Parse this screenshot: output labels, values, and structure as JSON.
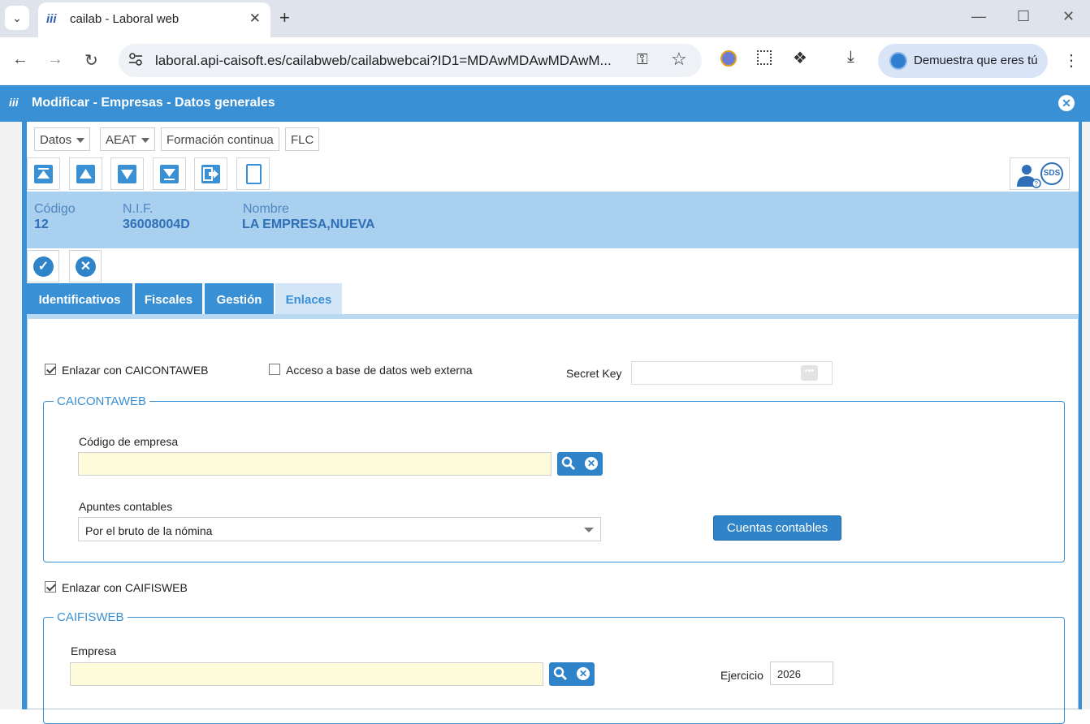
{
  "browser": {
    "tab_title": "cailab - Laboral web",
    "favicon_text": "iii",
    "url": "laboral.api-caisoft.es/cailabweb/cailabwebcai?ID1=MDAwMDAwMDAwM...",
    "profile_label": "Demuestra que eres tú"
  },
  "dialog": {
    "logo_text": "iii",
    "title": "Modificar - Empresas - Datos generales",
    "menus": [
      "Datos",
      "AEAT",
      "Formación continua",
      "FLC"
    ],
    "help_text": "SDS"
  },
  "record": {
    "codigo_label": "Código",
    "codigo_value": "12",
    "nif_label": "N.I.F.",
    "nif_value": "36008004D",
    "nombre_label": "Nombre",
    "nombre_value": "LA EMPRESA,NUEVA"
  },
  "tabs": [
    {
      "label": "Identificativos",
      "active": false
    },
    {
      "label": "Fiscales",
      "active": false
    },
    {
      "label": "Gestión",
      "active": false
    },
    {
      "label": "Enlaces",
      "active": true
    }
  ],
  "enlaces": {
    "enlazar_caicontaweb_label": "Enlazar con CAICONTAWEB",
    "enlazar_caicontaweb_checked": true,
    "acceso_externa_label": "Acceso a base de datos web externa",
    "acceso_externa_checked": false,
    "secret_key_label": "Secret Key",
    "secret_key_value": "",
    "caicontaweb_legend": "CAICONTAWEB",
    "codigo_empresa_label": "Código de empresa",
    "codigo_empresa_value": "",
    "apuntes_label": "Apuntes contables",
    "apuntes_value": "Por el bruto de la nómina",
    "cuentas_button": "Cuentas contables",
    "enlazar_caifisweb_label": "Enlazar con CAIFISWEB",
    "enlazar_caifisweb_checked": true,
    "caifisweb_legend": "CAIFISWEB",
    "empresa_label": "Empresa",
    "empresa_value": "",
    "ejercicio_label": "Ejercicio",
    "ejercicio_value": "2026"
  },
  "colors": {
    "accent": "#3a90d4",
    "record_band": "#a9d0ee",
    "required_field": "#fdfbd9"
  }
}
